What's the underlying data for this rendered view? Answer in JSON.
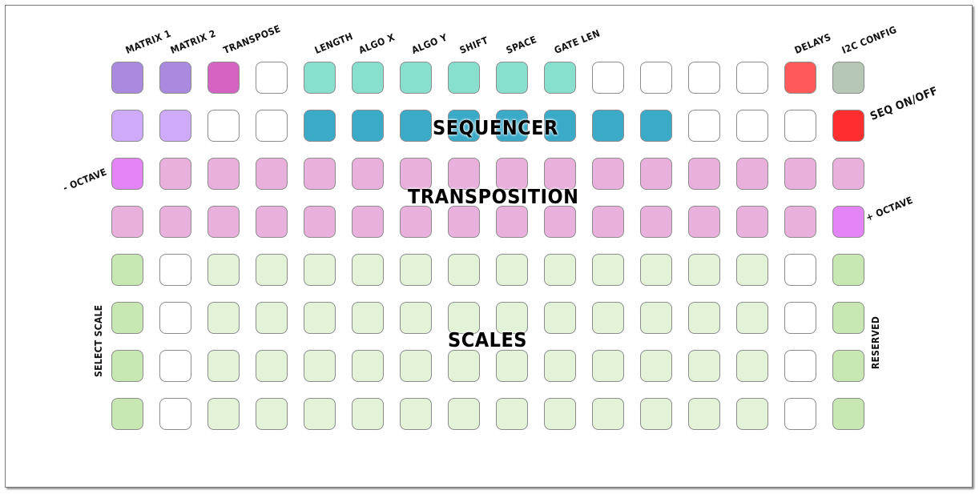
{
  "top_labels": {
    "matrix1": "MATRIX 1",
    "matrix2": "MATRIX 2",
    "transpose": "TRANSPOSE",
    "length": "LENGTH",
    "algo_x": "ALGO X",
    "algo_y": "ALGO Y",
    "shift": "SHIFT",
    "space": "SPACE",
    "gate_len": "GATE LEN",
    "delays": "DELAYS",
    "i2c_config": "I2C CONFIG"
  },
  "side_labels": {
    "seq_onoff": "SEQ ON/OFF",
    "minus_octave": "- OCTAVE",
    "plus_octave": "+ OCTAVE",
    "select_scale": "SELECT SCALE",
    "reserved": "RESERVED"
  },
  "sections": {
    "sequencer": "SEQUENCER",
    "transposition": "TRANSPOSITION",
    "scales": "SCALES"
  },
  "colors": {
    "W": "#ffffff",
    "P": "#a98ade",
    "LP": "#cfaafa",
    "M": "#d463c2",
    "T": "#88dfcd",
    "B": "#3aaac8",
    "R": "#ff5a5a",
    "RR": "#ff2e2e",
    "G": "#b6c8b5",
    "K": "#e9b0dd",
    "KV": "#e384f7",
    "GR": "#c7e8b3",
    "LG": "#e3f3d8"
  },
  "grid": [
    [
      "P",
      "P",
      "M",
      "W",
      "T",
      "T",
      "T",
      "T",
      "T",
      "T",
      "W",
      "W",
      "W",
      "W",
      "R",
      "G"
    ],
    [
      "LP",
      "LP",
      "W",
      "W",
      "B",
      "B",
      "B",
      "B",
      "B",
      "B",
      "B",
      "B",
      "W",
      "W",
      "W",
      "RR"
    ],
    [
      "KV",
      "K",
      "K",
      "K",
      "K",
      "K",
      "K",
      "K",
      "K",
      "K",
      "K",
      "K",
      "K",
      "K",
      "K",
      "K"
    ],
    [
      "K",
      "K",
      "K",
      "K",
      "K",
      "K",
      "K",
      "K",
      "K",
      "K",
      "K",
      "K",
      "K",
      "K",
      "K",
      "KV"
    ],
    [
      "GR",
      "W",
      "LG",
      "LG",
      "LG",
      "LG",
      "LG",
      "LG",
      "LG",
      "LG",
      "LG",
      "LG",
      "LG",
      "LG",
      "W",
      "GR"
    ],
    [
      "GR",
      "W",
      "LG",
      "LG",
      "LG",
      "LG",
      "LG",
      "LG",
      "LG",
      "LG",
      "LG",
      "LG",
      "LG",
      "LG",
      "W",
      "GR"
    ],
    [
      "GR",
      "W",
      "LG",
      "LG",
      "LG",
      "LG",
      "LG",
      "LG",
      "LG",
      "LG",
      "LG",
      "LG",
      "LG",
      "LG",
      "W",
      "GR"
    ],
    [
      "GR",
      "W",
      "LG",
      "LG",
      "LG",
      "LG",
      "LG",
      "LG",
      "LG",
      "LG",
      "LG",
      "LG",
      "LG",
      "LG",
      "W",
      "GR"
    ]
  ]
}
